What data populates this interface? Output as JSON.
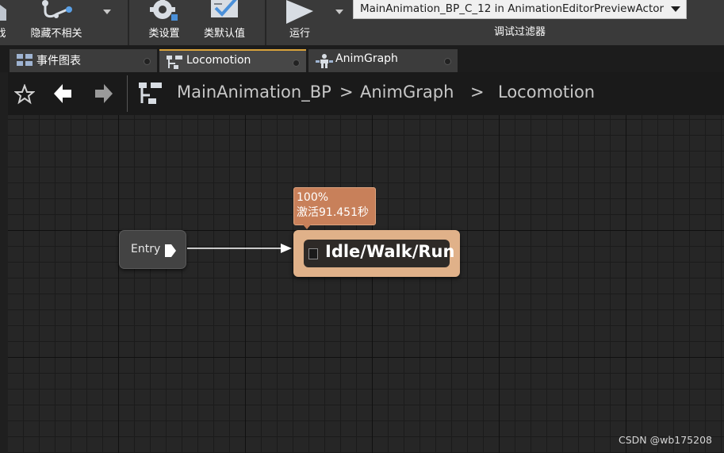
{
  "toolbar": {
    "partial_label": "戏",
    "hide_unrelated_label": "隐藏不相关",
    "class_settings_label": "类设置",
    "class_defaults_label": "类默认值",
    "run_label": "运行",
    "debug_filter_value": "MainAnimation_BP_C_12 in AnimationEditorPreviewActor",
    "debug_filter_label": "调试过滤器"
  },
  "tabs": [
    {
      "label": "事件图表",
      "icon": "event-graph-icon",
      "active": false
    },
    {
      "label": "Locomotion",
      "icon": "state-machine-icon",
      "active": true
    },
    {
      "label": "AnimGraph",
      "icon": "anim-graph-icon",
      "active": false
    }
  ],
  "breadcrumb": {
    "items": [
      "MainAnimation_BP",
      "AnimGraph",
      "Locomotion"
    ],
    "separator": ">"
  },
  "graph": {
    "entry_label": "Entry",
    "state_title": "Idle/Walk/Run",
    "tooltip_line1": "100%",
    "tooltip_line2": "激活91.451秒"
  },
  "watermark": "CSDN @wb175208",
  "colors": {
    "state_node": "#e0b189",
    "tooltip": "#c8805a",
    "active_tab_accent": "#d9a33b",
    "graph_background": "#262626"
  }
}
